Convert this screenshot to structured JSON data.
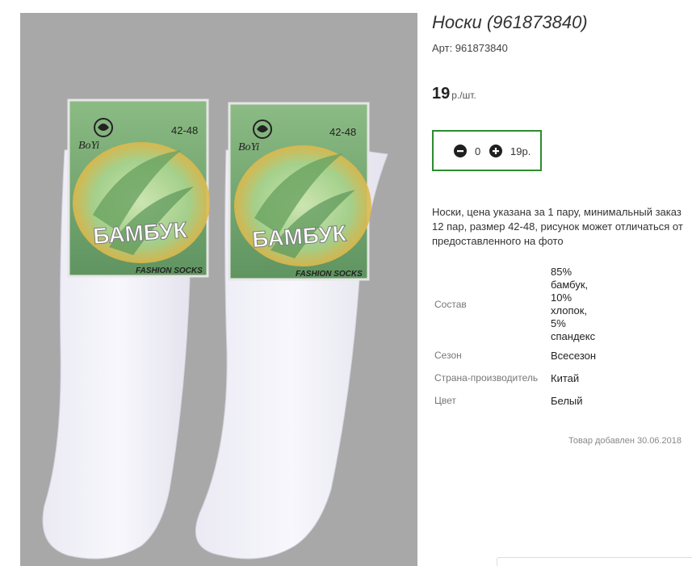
{
  "product": {
    "title": "Носки (961873840)",
    "sku": "Арт: 961873840",
    "price": "19",
    "price_unit": "р./шт.",
    "description": "Носки, цена указана за 1 пару, минимальный заказ 12 пар, размер 42-48, рисунок может отличаться от предоставленного на фото",
    "added": "Товар добавлен 30.06.2018"
  },
  "quantity": {
    "value": "0",
    "total": "19р."
  },
  "attributes": [
    {
      "label": "Состав",
      "value": "85%\nбамбук,\n10%\nхлопок,\n5%\nспандекс"
    },
    {
      "label": "Сезон",
      "value": "Всесезон"
    },
    {
      "label": "Страна-производитель",
      "value": "Китай"
    },
    {
      "label": "Цвет",
      "value": "Белый"
    }
  ],
  "photo": {
    "brand": "BoYi",
    "size": "42-48",
    "label_text": "БАМБУК",
    "tagline": "FASHION SOCKS"
  },
  "colors": {
    "accent_border": "#2e8b2e",
    "photo_background": "#a9a8a8",
    "label_green": "#7fb07a"
  }
}
